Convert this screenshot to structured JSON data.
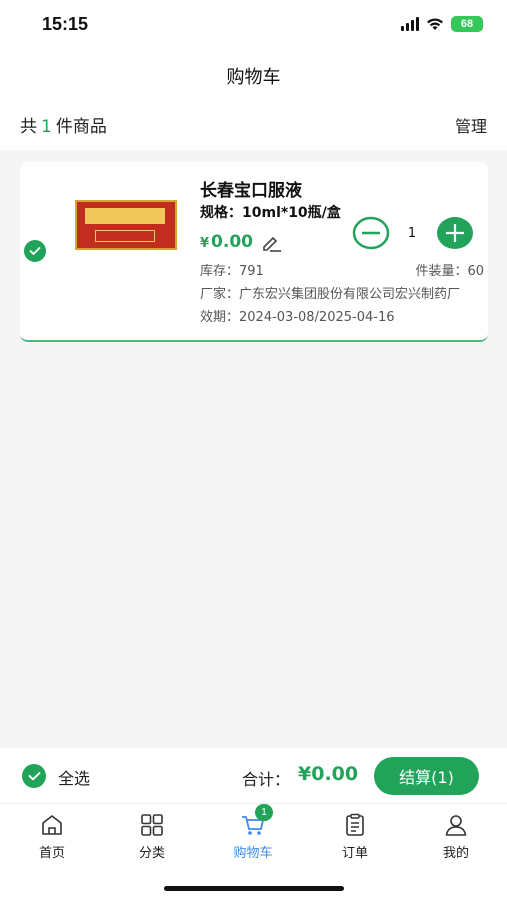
{
  "status_bar": {
    "time": "15:15",
    "battery": "68"
  },
  "nav": {
    "title": "购物车"
  },
  "summary": {
    "prefix": "共",
    "count": "1",
    "suffix": "件商品",
    "manage_label": "管理"
  },
  "cart_items": [
    {
      "name": "长春宝口服液",
      "spec": "规格：10ml*10瓶/盒",
      "price_symbol": "¥",
      "price": "0.00",
      "quantity": "1",
      "stock": "库存：791",
      "pack": "件装量：60",
      "maker": "厂家：广东宏兴集团股份有限公司宏兴制药厂",
      "expiry": "效期：2024-03-08/2025-04-16",
      "checked": true
    }
  ],
  "checkout": {
    "select_all_label": "全选",
    "total_label": "合计：",
    "total_value": "¥0.00",
    "checkout_label": "结算(1)"
  },
  "tabs": [
    {
      "label": "首页",
      "icon": "home-icon"
    },
    {
      "label": "分类",
      "icon": "grid-icon"
    },
    {
      "label": "购物车",
      "icon": "cart-icon",
      "badge": "1",
      "active": true
    },
    {
      "label": "订单",
      "icon": "clipboard-icon"
    },
    {
      "label": "我的",
      "icon": "user-icon"
    }
  ],
  "colors": {
    "accent": "#21a35a",
    "active_tab": "#3d8be8"
  }
}
